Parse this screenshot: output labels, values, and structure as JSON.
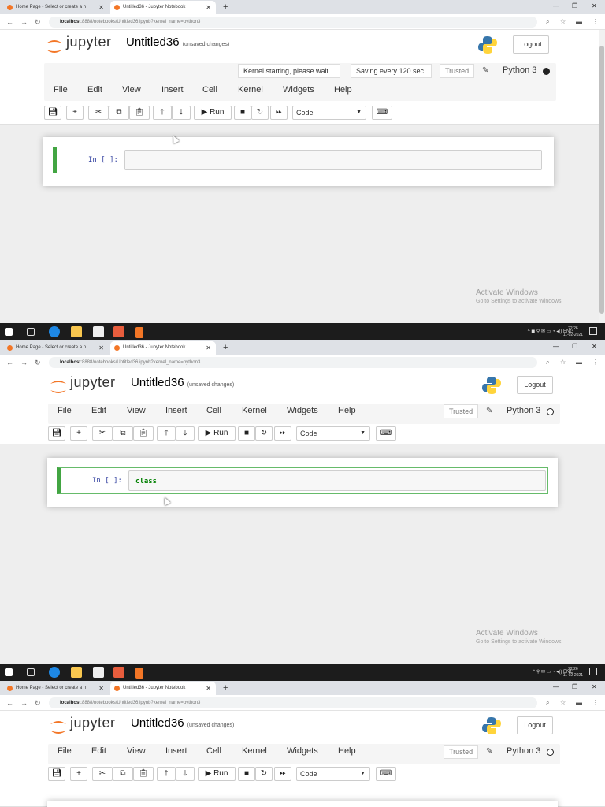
{
  "browser": {
    "tabs": [
      {
        "title": "Home Page - Select or create a n",
        "favicon": "jupyter-icon"
      },
      {
        "title": "Untitled36 - Jupyter Notebook",
        "favicon": "jupyter-icon"
      }
    ],
    "url_host": "localhost",
    "url_rest": ":8888/notebooks/Untitled36.ipynb?kernel_name=python3"
  },
  "jupyter": {
    "brand": "jupyter",
    "notebook_title": "Untitled36",
    "unsaved": "(unsaved changes)",
    "logout": "Logout",
    "menu": [
      "File",
      "Edit",
      "View",
      "Insert",
      "Cell",
      "Kernel",
      "Widgets",
      "Help"
    ],
    "notif_kernel": "Kernel starting, please wait...",
    "notif_autosave": "Saving every 120 sec.",
    "trusted": "Trusted",
    "kernel_name": "Python 3",
    "run_label": "Run",
    "cell_type": "Code",
    "prompt": "In [ ]:",
    "code_frame2": "class"
  },
  "windows": {
    "activate_title": "Activate Windows",
    "activate_sub": "Go to Settings to activate Windows.",
    "lang": "ENG",
    "time": "22:26",
    "date": "11-02-2021"
  },
  "colors": {
    "accent_green": "#42a542",
    "jupyter_orange": "#f37626",
    "python_blue": "#3776ab",
    "python_yellow": "#ffd43b"
  }
}
